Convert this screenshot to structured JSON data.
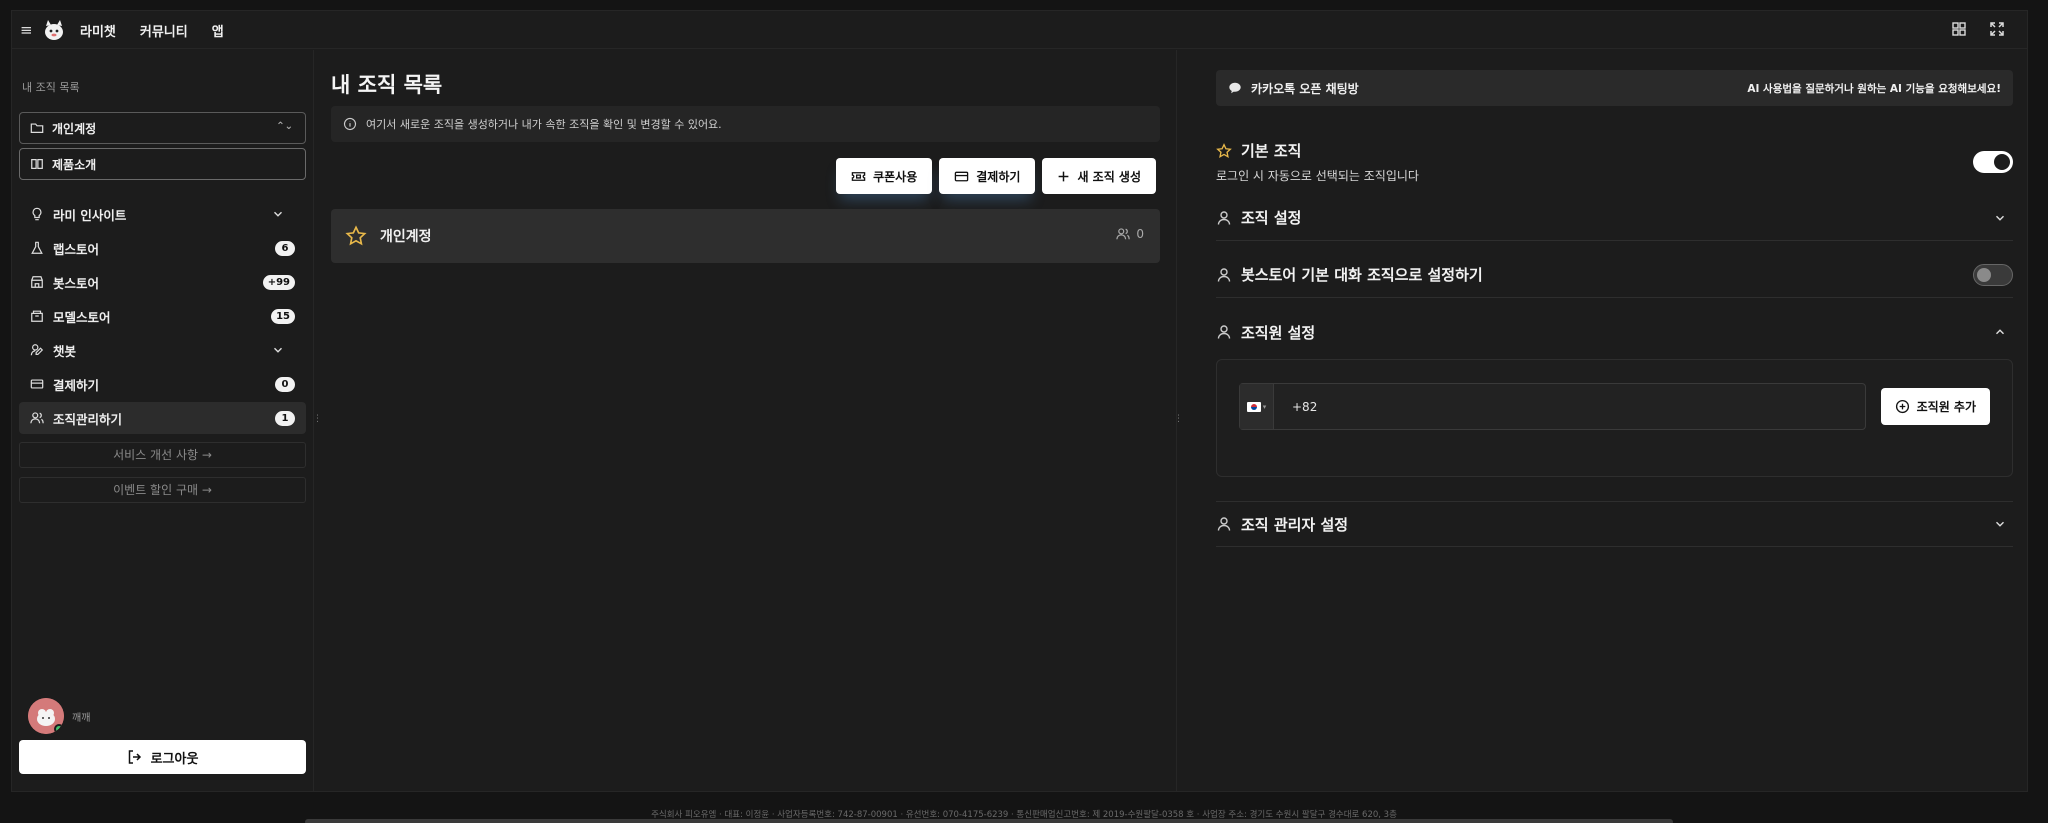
{
  "topbar": {
    "nav": [
      "라미챗",
      "커뮤니티",
      "앱"
    ]
  },
  "sidebar": {
    "section_label": "내 조직 목록",
    "org_select": "개인계정",
    "product_intro": "제품소개",
    "items": [
      {
        "label": "라미 인사이트",
        "icon": "lightbulb-icon",
        "chevron": true
      },
      {
        "label": "랩스토어",
        "icon": "flask-icon",
        "badge": "6"
      },
      {
        "label": "봇스토어",
        "icon": "store-icon",
        "badge": "+99"
      },
      {
        "label": "모델스토어",
        "icon": "package-icon",
        "badge": "15"
      },
      {
        "label": "챗봇",
        "icon": "bot-icon",
        "chevron": true
      },
      {
        "label": "결제하기",
        "icon": "card-icon",
        "badge": "0"
      },
      {
        "label": "조직관리하기",
        "icon": "users-icon",
        "badge": "1"
      }
    ],
    "service_improve": "서비스 개선 사항 →",
    "event_discount": "이벤트 할인 구매 →",
    "username": "깨깨",
    "logout": "로그아웃"
  },
  "main": {
    "title": "내 조직 목록",
    "info": "여기서 새로운 조직을 생성하거나 내가 속한 조직을 확인 및 변경할 수 있어요.",
    "coupon_btn": "쿠폰사용",
    "pay_btn": "결제하기",
    "new_org_btn": "새 조직 생성",
    "orgs": [
      {
        "name": "개인계정",
        "members": "0"
      }
    ]
  },
  "right": {
    "kakao_label": "카카오톡 오픈 채팅방",
    "kakao_hint": "AI 사용법을 질문하거나 원하는 AI 기능을 요청해보세요!",
    "default_org_title": "기본 조직",
    "default_org_desc": "로그인 시 자동으로 선택되는 조직입니다",
    "default_org_toggle": true,
    "org_settings": "조직 설정",
    "botstore_default": "봇스토어 기본 대화 조직으로 설정하기",
    "botstore_toggle": false,
    "member_settings": "조직원 설정",
    "phone_code": "+82",
    "add_member": "조직원 추가",
    "admin_settings": "조직 관리자 설정"
  },
  "footer": "주식회사 피오유엠 · 대표: 이정윤 · 사업자등록번호: 742-87-00901 · 유선번호: 070-4175-6239 · 통신판매업신고번호: 제 2019-수원팔달-0358 호 · 사업장 주소: 경기도 수원시 팔달구 경수대로 620, 3층"
}
